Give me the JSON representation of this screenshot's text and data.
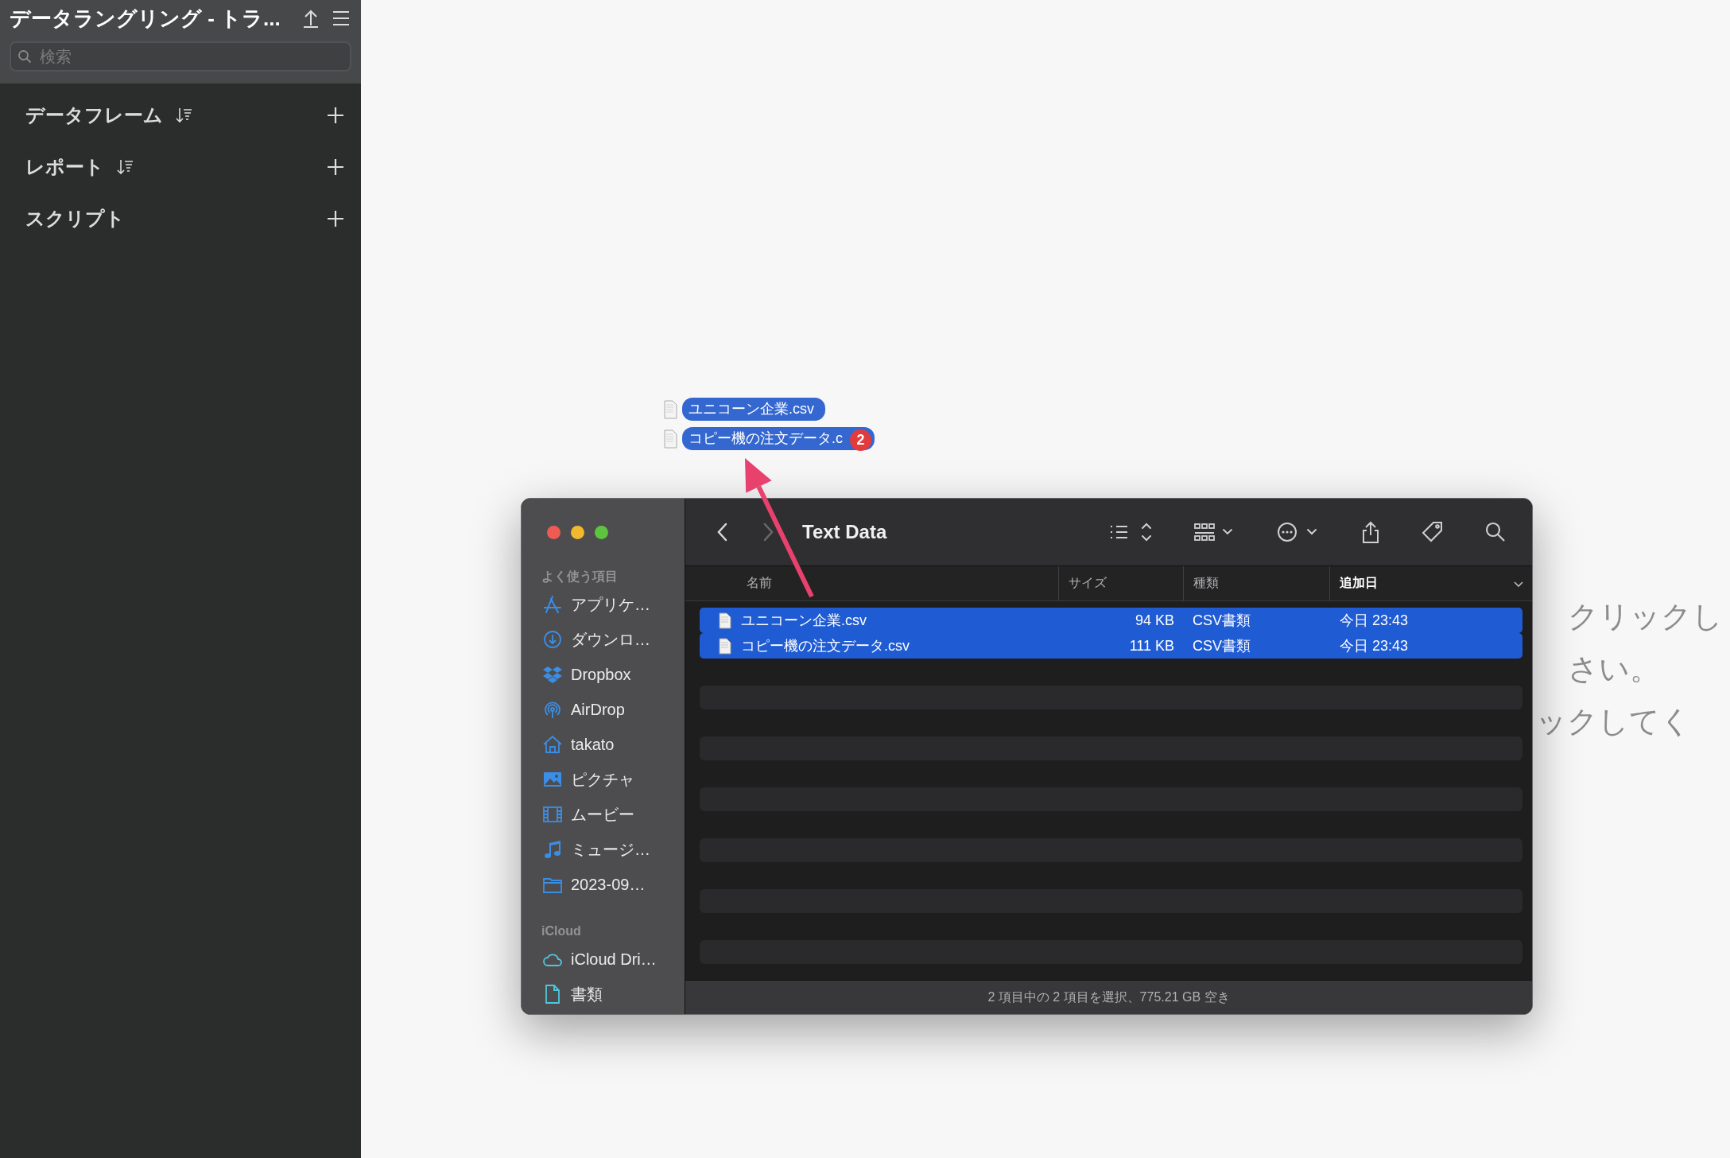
{
  "app": {
    "title": "データラングリング - トラ...",
    "search": {
      "placeholder": "検索"
    },
    "sections": [
      {
        "label": "データフレーム",
        "sortable": true
      },
      {
        "label": "レポート",
        "sortable": true
      },
      {
        "label": "スクリプト",
        "sortable": false
      }
    ]
  },
  "hint_lines": [
    "クリックし",
    "さい。",
    "ックしてく"
  ],
  "drag": {
    "items": [
      {
        "name": "ユニコーン企業.csv"
      },
      {
        "name": "コピー機の注文データ.c"
      }
    ],
    "count": "2"
  },
  "finder": {
    "title": "Text Data",
    "navigation": {
      "back_disabled": false,
      "forward_disabled": true
    },
    "sidebar": [
      {
        "heading": "よく使う項目",
        "items": [
          {
            "label": "アプリケ…",
            "kind": "apps"
          },
          {
            "label": "ダウンロ…",
            "kind": "download"
          },
          {
            "label": "Dropbox",
            "kind": "dropbox"
          },
          {
            "label": "AirDrop",
            "kind": "airdrop"
          },
          {
            "label": "takato",
            "kind": "home"
          },
          {
            "label": "ピクチャ",
            "kind": "pictures"
          },
          {
            "label": "ムービー",
            "kind": "movies"
          },
          {
            "label": "ミュージ…",
            "kind": "music"
          },
          {
            "label": "2023-09…",
            "kind": "folder"
          }
        ]
      },
      {
        "heading": "iCloud",
        "items": [
          {
            "label": "iCloud Dri…",
            "kind": "cloud"
          },
          {
            "label": "書類",
            "kind": "document"
          }
        ]
      }
    ],
    "columns": [
      {
        "label": "名前",
        "sorted": false
      },
      {
        "label": "サイズ",
        "sorted": false
      },
      {
        "label": "種類",
        "sorted": false
      },
      {
        "label": "追加日",
        "sorted": true
      }
    ],
    "rows": [
      {
        "name": "ユニコーン企業.csv",
        "size": "94 KB",
        "file_type": "CSV書類",
        "date": "今日 23:43",
        "selected": true
      },
      {
        "name": "コピー機の注文データ.csv",
        "size": "111 KB",
        "file_type": "CSV書類",
        "date": "今日 23:43",
        "selected": true
      }
    ],
    "status": "2 項目中の 2 項目を選択、775.21 GB 空き"
  }
}
